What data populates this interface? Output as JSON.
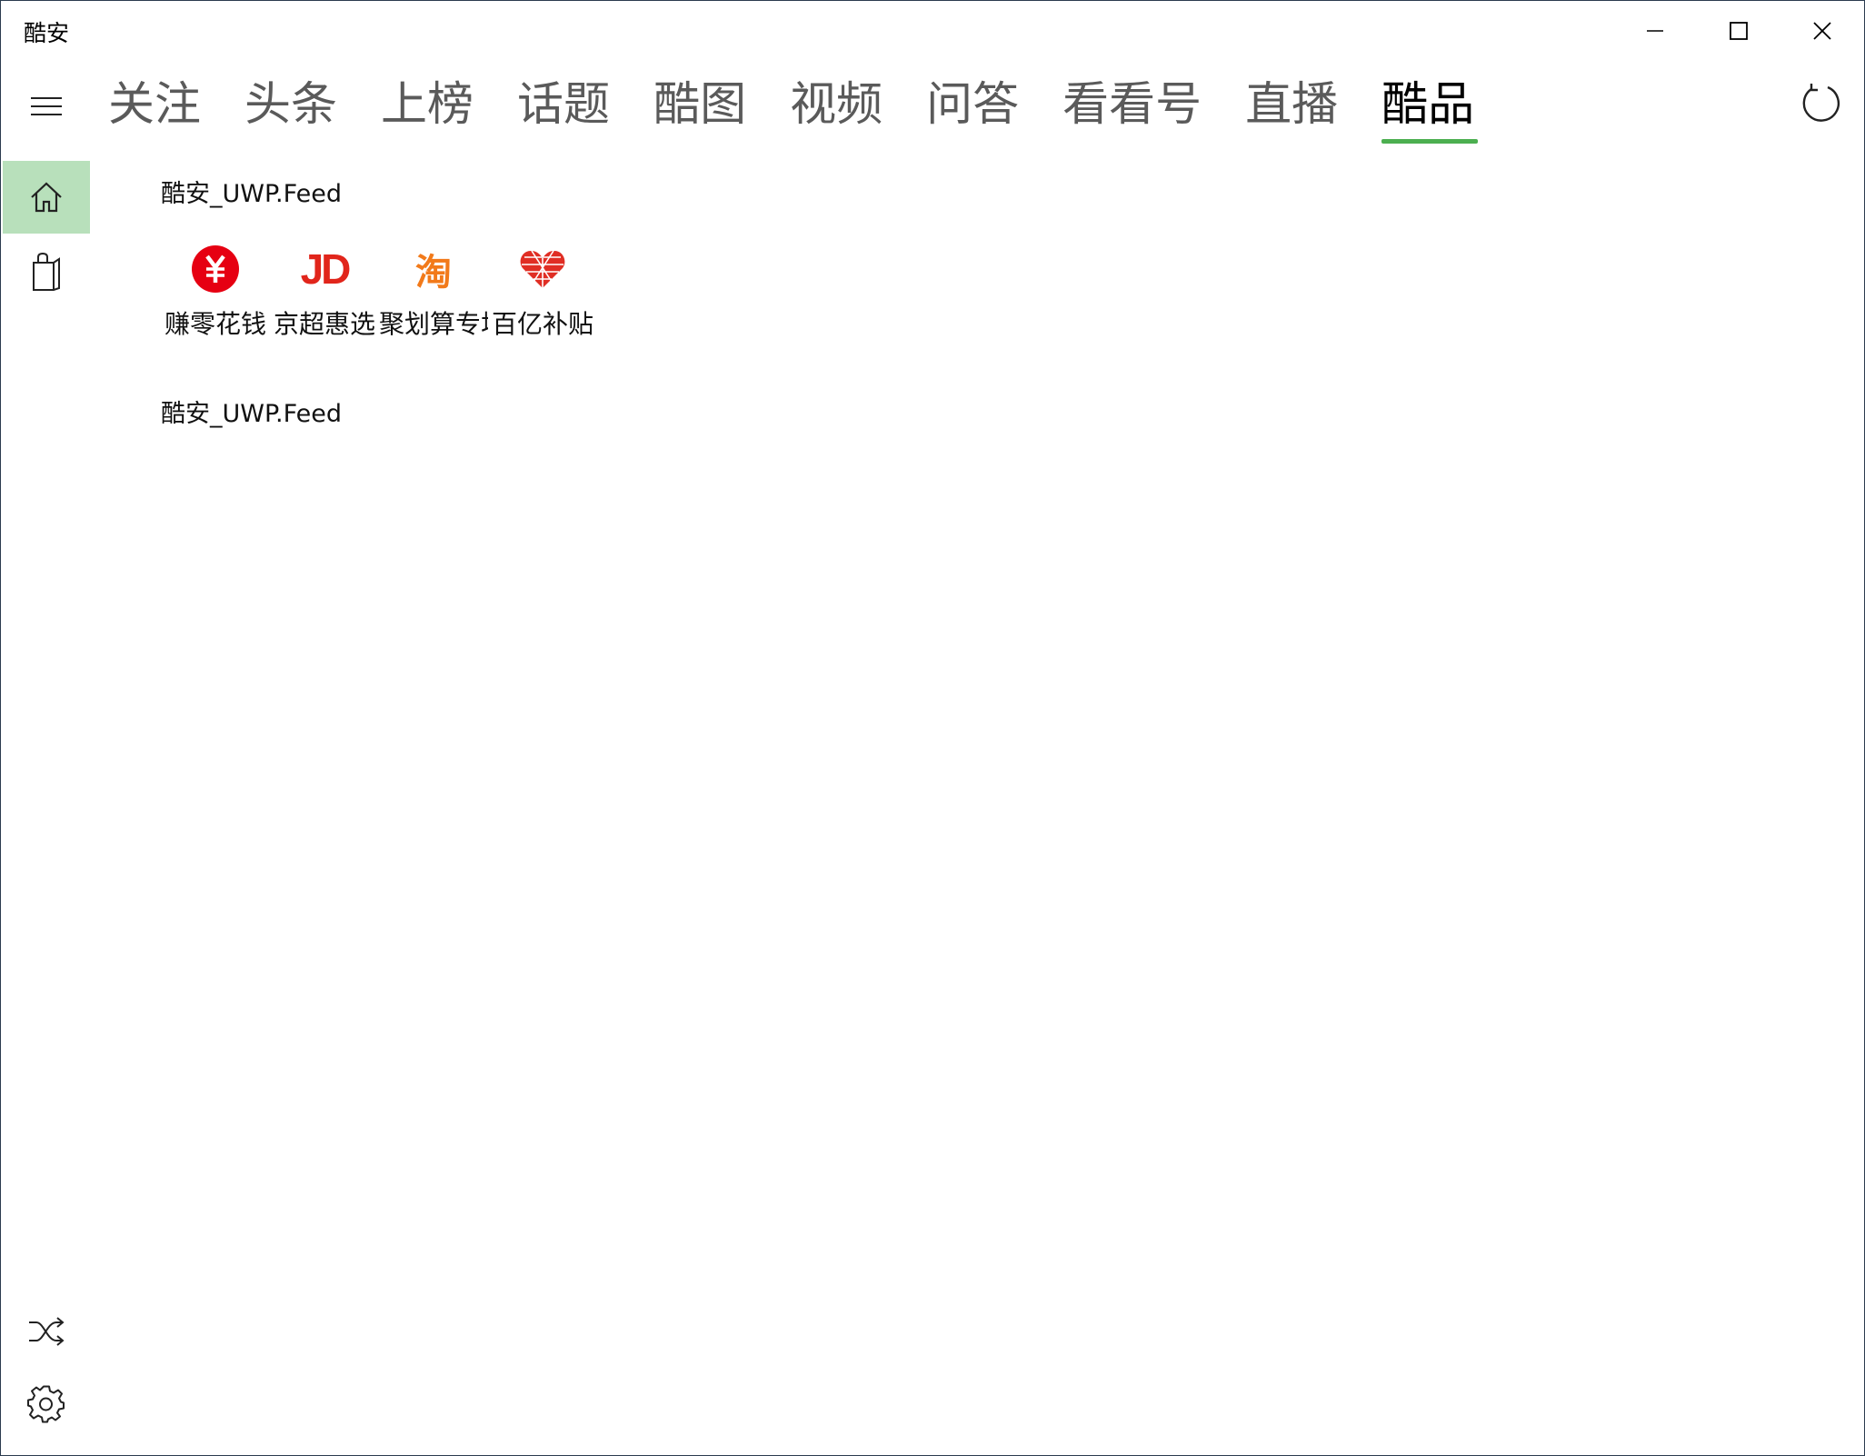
{
  "window": {
    "title": "酷安",
    "controls": [
      "minimize-icon",
      "maximize-icon",
      "close-icon"
    ]
  },
  "nav": {
    "menu_icon": "hamburger-icon",
    "tabs": [
      {
        "label": "关注"
      },
      {
        "label": "头条"
      },
      {
        "label": "上榜"
      },
      {
        "label": "话题"
      },
      {
        "label": "酷图"
      },
      {
        "label": "视频"
      },
      {
        "label": "问答"
      },
      {
        "label": "看看号"
      },
      {
        "label": "直播"
      },
      {
        "label": "酷品"
      }
    ],
    "active_tab": "酷品",
    "accent_color": "#4caf50",
    "refresh_icon": "refresh-icon"
  },
  "sidebar": {
    "items": [
      {
        "icon": "home-icon",
        "selected": true,
        "highlight_color": "#b8e0bb"
      },
      {
        "icon": "shopping-bag-icon",
        "selected": false
      }
    ],
    "bottom_items": [
      {
        "icon": "shuffle-icon"
      },
      {
        "icon": "gear-icon"
      }
    ]
  },
  "content": {
    "feed_title_1": "酷安_UWP.Feed",
    "shortcuts": [
      {
        "label": "赚零花钱",
        "icon": "yuan-coin-icon",
        "color": "#e60012"
      },
      {
        "label": "京超惠选",
        "icon": "jd-logo-icon",
        "icon_text": "JD",
        "color": "#e1251b"
      },
      {
        "label": "聚划算专场",
        "icon": "taobao-logo-icon",
        "icon_text": "淘",
        "color": "#f27a1a"
      },
      {
        "label": "百亿补贴",
        "icon": "pinduoduo-heart-icon",
        "color": "#e02e24"
      }
    ],
    "feed_title_2": "酷安_UWP.Feed"
  }
}
